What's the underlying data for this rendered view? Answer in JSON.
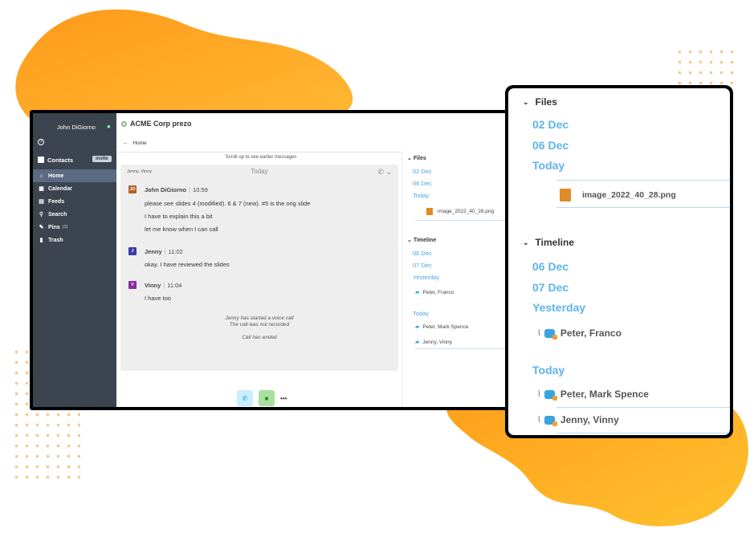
{
  "sidebar": {
    "user_name": "John DiGiorno",
    "contacts_label": "Contacts",
    "invite_label": "invite",
    "items": [
      {
        "label": "Home",
        "icon": "home-icon",
        "active": true,
        "count": ""
      },
      {
        "label": "Calendar",
        "icon": "calendar-icon",
        "active": false,
        "count": ""
      },
      {
        "label": "Feeds",
        "icon": "feeds-icon",
        "active": false,
        "count": ""
      },
      {
        "label": "Search",
        "icon": "search-icon",
        "active": false,
        "count": ""
      },
      {
        "label": "Pins",
        "icon": "pin-icon",
        "active": false,
        "count": "(2)"
      },
      {
        "label": "Trash",
        "icon": "trash-icon",
        "active": false,
        "count": ""
      }
    ]
  },
  "header": {
    "title": "ACME Corp prezo",
    "breadcrumb": "Home"
  },
  "chat": {
    "scroll_hint": "Scroll up to see earlier messages",
    "participants": "Jenny, Vinny",
    "day": "Today",
    "messages": [
      {
        "initials": "JO",
        "name": "John DiGiorno",
        "time": "10:59",
        "color": "#b0622a",
        "lines": [
          "please see slides 4 (modified). 6 & 7 (new). #5 is the  orig slide",
          "I have to explain this a bit",
          "let me know when I can call"
        ]
      },
      {
        "initials": "J",
        "name": "Jenny",
        "time": "11:02",
        "color": "#3a3aa8",
        "lines": [
          "okay. I have reviewed the slides"
        ]
      },
      {
        "initials": "V",
        "name": "Vinny",
        "time": "11:04",
        "color": "#8a2aa0",
        "lines": [
          "I have too"
        ]
      }
    ],
    "system": [
      "Jenny has started a voice call",
      "The call was not recorded",
      "Call has ended"
    ]
  },
  "right_panel": {
    "files_label": "Files",
    "files_dates": [
      "02 Dec",
      "06 Dec",
      "Today"
    ],
    "file_name": "image_2022_40_28.png",
    "timeline_label": "Timeline",
    "timeline_dates": [
      "06 Dec",
      "07 Dec",
      "Yesterday"
    ],
    "timeline_people_1": "Peter, Franco",
    "timeline_today": "Today",
    "timeline_people_2": "Peter, Mark Spence",
    "timeline_people_3": "Jenny, Vinny"
  },
  "colors": {
    "accent_blue": "#5eb4ea",
    "sidebar_bg": "#3c4450",
    "blob_orange": "#ffa41b"
  }
}
